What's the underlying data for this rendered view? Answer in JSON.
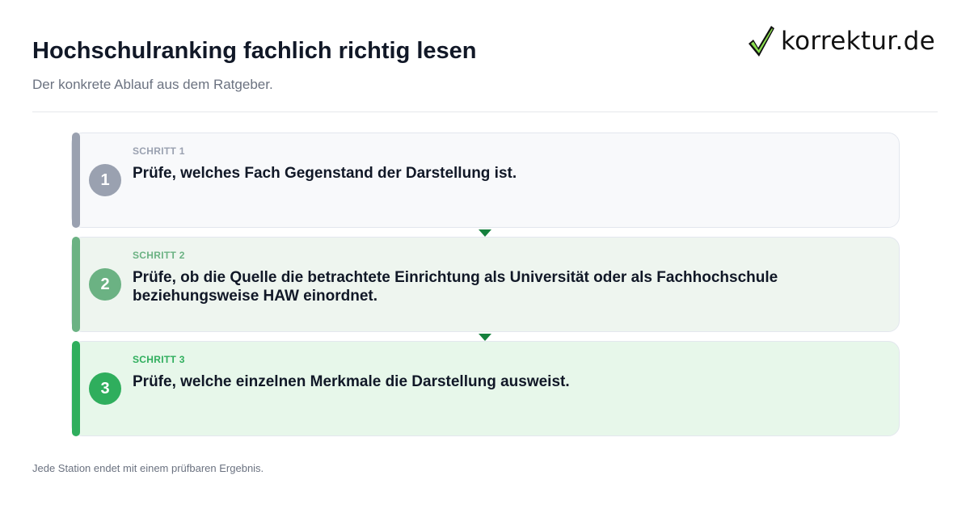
{
  "header": {
    "title": "Hochschulranking fachlich richtig lesen",
    "subtitle": "Der konkrete Ablauf aus dem Ratgeber."
  },
  "logo": {
    "text": "korrektur.de",
    "icon": "checkmark-icon"
  },
  "steps": [
    {
      "number": "1",
      "label": "SCHRITT 1",
      "text": "Prüfe, welches Fach Gegenstand der Darstellung ist.",
      "color": "#9aa1b0"
    },
    {
      "number": "2",
      "label": "SCHRITT 2",
      "text": "Prüfe, ob die Quelle die betrachtete Einrichtung als Universität oder als Fachhochschule beziehungsweise HAW einordnet.",
      "color": "#6bb283"
    },
    {
      "number": "3",
      "label": "SCHRITT 3",
      "text": "Prüfe, welche einzelnen Merkmale die Darstellung ausweist.",
      "color": "#2fae5d"
    }
  ],
  "footer": {
    "note": "Jede Station endet mit einem prüfbaren Ergebnis."
  },
  "colors": {
    "arrow": "#15803d",
    "title": "#111827",
    "muted": "#6b7280"
  }
}
